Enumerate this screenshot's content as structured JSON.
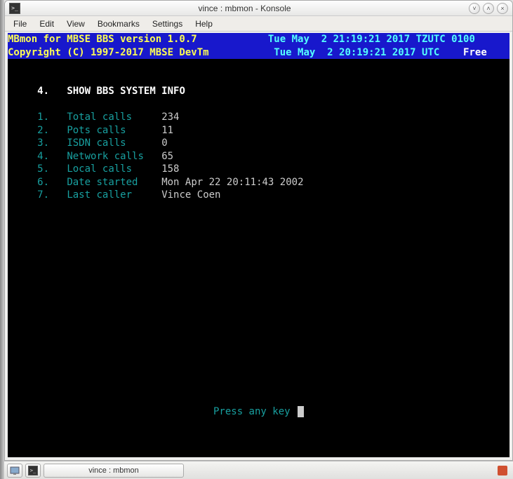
{
  "window": {
    "title": "vince : mbmon - Konsole"
  },
  "menubar": {
    "items": [
      "File",
      "Edit",
      "View",
      "Bookmarks",
      "Settings",
      "Help"
    ]
  },
  "header": {
    "line1_left": "MBmon for MBSE BBS version 1.0.7",
    "line1_right": "Tue May  2 21:19:21 2017 TZUTC 0100",
    "line2_left": "Copyright (C) 1997-2017 MBSE DevTm",
    "line2_right_time": "Tue May  2 20:19:21 2017 UTC",
    "line2_right_free": "Free"
  },
  "section": {
    "number": "4.",
    "title": "SHOW BBS SYSTEM INFO"
  },
  "rows": [
    {
      "num": "1.",
      "label": "Total calls",
      "value": "234"
    },
    {
      "num": "2.",
      "label": "Pots calls",
      "value": "11"
    },
    {
      "num": "3.",
      "label": "ISDN calls",
      "value": "0"
    },
    {
      "num": "4.",
      "label": "Network calls",
      "value": "65"
    },
    {
      "num": "5.",
      "label": "Local calls",
      "value": "158"
    },
    {
      "num": "6.",
      "label": "Date started",
      "value": "Mon Apr 22 20:11:43 2002"
    },
    {
      "num": "7.",
      "label": "Last caller",
      "value": "Vince Coen"
    }
  ],
  "prompt": "Press any key ",
  "taskbar": {
    "task_label": "vince : mbmon"
  }
}
